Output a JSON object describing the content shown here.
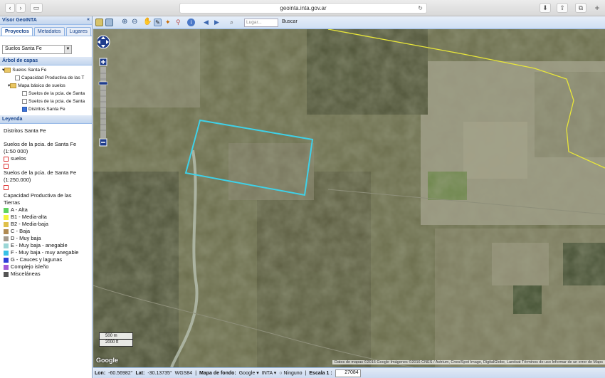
{
  "browser": {
    "url": "geointa.inta.gov.ar"
  },
  "app": {
    "title": "Visor GeoINTA",
    "collapse": "«"
  },
  "tabs": [
    "Proyectos",
    "Metadatos",
    "Lugares"
  ],
  "project_select": "Suelos Santa Fe",
  "layer_tree": {
    "title": "Árbol de capas",
    "nodes": [
      {
        "label": "Suelos Santa Fe",
        "level": 0,
        "checked": false,
        "folder": true
      },
      {
        "label": "Capacidad Productiva de las T",
        "level": 2,
        "checked": false,
        "folder": false
      },
      {
        "label": "Mapa básico de suelos",
        "level": 1,
        "checked": false,
        "folder": true
      },
      {
        "label": "Suelos de la pcia. de Santa",
        "level": 2,
        "checked": false,
        "folder": false
      },
      {
        "label": "Suelos de la pcia. de Santa",
        "level": 2,
        "checked": false,
        "folder": false
      },
      {
        "label": "Distritos Santa Fe",
        "level": 1,
        "checked": true,
        "folder": false
      }
    ]
  },
  "legend": {
    "title": "Leyenda",
    "district": "Distritos Santa Fe",
    "suelos50_title_1": "Suelos de la pcia. de Santa Fe",
    "suelos50_title_2": "(1:50 000)",
    "suelos50_item": "suelos",
    "suelos250_title_1": "Suelos de la pcia. de Santa Fe",
    "suelos250_title_2": "(1:250.000)",
    "cap_title_1": "Capacidad Productiva de las",
    "cap_title_2": "Tierras",
    "items": [
      {
        "label": "A - Alta",
        "color": "#5fd35f"
      },
      {
        "label": "B1 - Media-alta",
        "color": "#f2f23c"
      },
      {
        "label": "B2 - Media-baja",
        "color": "#e0c04a"
      },
      {
        "label": "C - Baja",
        "color": "#b08a52"
      },
      {
        "label": "D - Muy baja",
        "color": "#a49a8c"
      },
      {
        "label": "E - Muy baja - anegable",
        "color": "#9bd6d6"
      },
      {
        "label": "F - Muy baja - muy anegable",
        "color": "#37c1e6"
      },
      {
        "label": "G - Cauces y lagunas",
        "color": "#2f3fd8"
      },
      {
        "label": "Complejo isleño",
        "color": "#a25ad6"
      },
      {
        "label": "Misceláneas",
        "color": "#555555"
      }
    ]
  },
  "search": {
    "placeholder": "Lugar...",
    "button": "Buscar"
  },
  "scale_bar": {
    "metric": "500 m",
    "imperial": "2000 ft"
  },
  "map_logo": "Google",
  "attribution": "Datos de mapas ©2016 Google Imágenes ©2016 CNES / Astrium, Cnes/Spot Image, DigitalGlobe, Landsat   Términos de uso   Informar de un error de Maps",
  "status": {
    "lon_label": "Lon:",
    "lon": "-60.56982°",
    "lat_label": "Lat:",
    "lat": "-30.13735°",
    "crs": "WGS84",
    "basemap_label": "Mapa de fondo:",
    "basemap": "Google",
    "layer": "INTA",
    "none": "Ninguno",
    "scale_label": "Escala 1 :",
    "scale": "27084"
  }
}
